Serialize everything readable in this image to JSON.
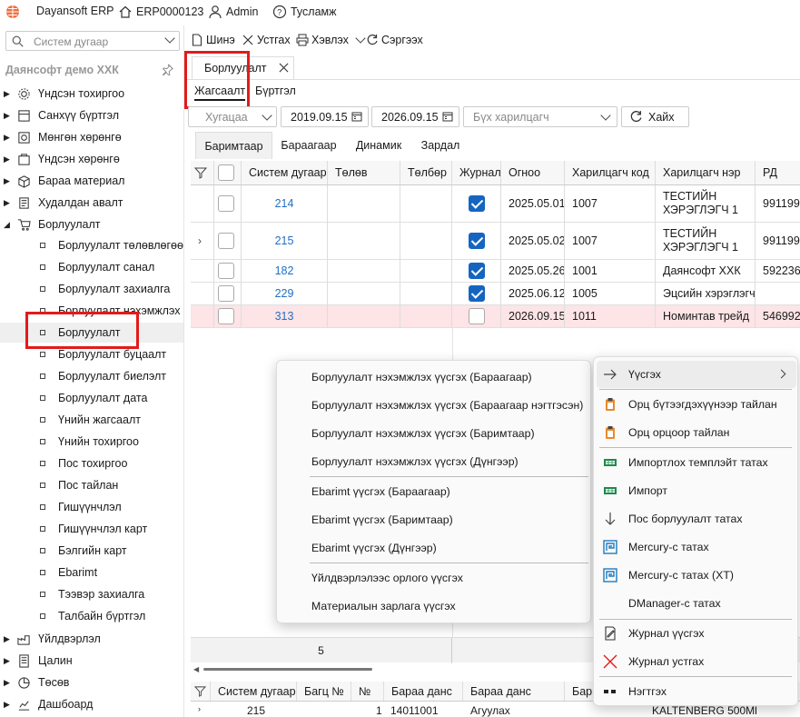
{
  "top": {
    "app": "Dayansoft ERP",
    "db": "ERP0000123",
    "user": "Admin",
    "help": "Тусламж"
  },
  "sidebar": {
    "search_placeholder": "Систем дугаар",
    "company": "Даянсофт демо ХХК",
    "top_items": [
      {
        "label": "Үндсэн тохиргоо",
        "icon": "gear-icon"
      },
      {
        "label": "Санхүү бүртгэл",
        "icon": "ledger-icon"
      },
      {
        "label": "Мөнгөн хөрөнгө",
        "icon": "money-icon"
      },
      {
        "label": "Үндсэн хөрөнгө",
        "icon": "asset-icon"
      },
      {
        "label": "Бараа материал",
        "icon": "box-icon"
      },
      {
        "label": "Худалдан авалт",
        "icon": "purchase-icon"
      },
      {
        "label": "Борлуулалт",
        "icon": "cart-icon"
      }
    ],
    "sub_items": [
      "Борлуулалт төлөвлөгөө",
      "Борлуулалт санал",
      "Борлуулалт захиалга",
      "Борлуулалт нэхэмжлэх",
      "Борлуулалт",
      "Борлуулалт буцаалт",
      "Борлуулалт биелэлт",
      "Борлуулалт дата",
      "Үнийн жагсаалт",
      "Үнийн тохиргоо",
      "Пос тохиргоо",
      "Пос тайлан",
      "Гишүүнчлэл",
      "Гишүүнчлэл карт",
      "Бэлгийн карт",
      "Ebarimt",
      "Тээвэр захиалга",
      "Талбайн бүртгэл"
    ],
    "bottom_items": [
      {
        "label": "Үйлдвэрлэл",
        "icon": "factory-icon"
      },
      {
        "label": "Цалин",
        "icon": "salary-icon"
      },
      {
        "label": "Төсөв",
        "icon": "pie-icon"
      },
      {
        "label": "Дашбоард",
        "icon": "dashboard-icon"
      }
    ]
  },
  "toolbar": {
    "new": "Шинэ",
    "delete": "Устгах",
    "print": "Хэвлэх",
    "refresh": "Сэргээх"
  },
  "doc_tab": {
    "label": "Борлуулалт"
  },
  "subtabs": {
    "list": "Жагсаалт",
    "register": "Бүртгэл"
  },
  "filters": {
    "period_placeholder": "Хугацаа",
    "date_from": "2019.09.15",
    "date_to": "2026.09.15",
    "partner_placeholder": "Бүх харилцагч",
    "search_button": "Хайх"
  },
  "tabs2": [
    "Баримтаар",
    "Бараагаар",
    "Динамик",
    "Зардал"
  ],
  "grid": {
    "headers": [
      "Систем дугаар",
      "Төлөв",
      "Төлбөр",
      "Журнал",
      "Огноо",
      "Харилцагч код",
      "Харилцагч нэр",
      "РД"
    ],
    "rows": [
      {
        "no": "214",
        "journal": true,
        "date": "2025.05.01",
        "code": "1007",
        "name1": "ТЕСТИЙН",
        "name2": "ХЭРЭГЛЭГЧ 1",
        "rd": "991199"
      },
      {
        "no": "215",
        "journal": true,
        "date": "2025.05.02",
        "code": "1007",
        "name1": "ТЕСТИЙН",
        "name2": "ХЭРЭГЛЭГЧ 1",
        "rd": "991199"
      },
      {
        "no": "182",
        "journal": true,
        "date": "2025.05.26",
        "code": "1001",
        "name1": "Даянсофт ХХК",
        "name2": "",
        "rd": "592236"
      },
      {
        "no": "229",
        "journal": true,
        "date": "2025.06.12",
        "code": "1005",
        "name1": "Эцсийн хэрэглэгч",
        "name2": "",
        "rd": ""
      },
      {
        "no": "313",
        "journal": false,
        "date": "2026.09.15",
        "code": "1011",
        "name1": "Номинтав трейд",
        "name2": "",
        "rd": "546992"
      }
    ],
    "count": "5"
  },
  "menu_left": [
    "Борлуулалт нэхэмжлэх үүсгэх (Бараагаар)",
    "Борлуулалт нэхэмжлэх үүсгэх (Бараагаар нэгтгэсэн)",
    "Борлуулалт нэхэмжлэх үүсгэх (Баримтаар)",
    "Борлуулалт нэхэмжлэх үүсгэх (Дүнгээр)",
    "Ebarimt үүсгэх (Бараагаар)",
    "Ebarimt үүсгэх (Баримтаар)",
    "Ebarimt үүсгэх (Дүнгээр)",
    "Үйлдвэрлэлээс орлого үүсгэх",
    "Материалын зарлага үүсгэх"
  ],
  "menu_right": [
    {
      "label": "Үүсгэх",
      "icon": "arrow-right-icon"
    },
    {
      "label": "Орц бүтээгдэхүүнээр тайлан",
      "icon": "clipboard-icon"
    },
    {
      "label": "Орц орцоор тайлан",
      "icon": "clipboard-icon"
    },
    {
      "label": "Импортлох темплэйт татах",
      "icon": "excel-icon"
    },
    {
      "label": "Импорт",
      "icon": "excel-icon"
    },
    {
      "label": "Пос борлуулалт татах",
      "icon": "arrow-down-icon"
    },
    {
      "label": "Mercury-с татах",
      "icon": "mercury-icon"
    },
    {
      "label": "Mercury-с татах (ХТ)",
      "icon": "mercury-icon"
    },
    {
      "label": "DManager-с татах",
      "icon": ""
    },
    {
      "label": "Журнал үүсгэх",
      "icon": "journal-icon"
    },
    {
      "label": "Журнал устгах",
      "icon": "red-x-icon"
    },
    {
      "label": "Нэгтгэх",
      "icon": "merge-icon"
    }
  ],
  "bottom_grid": {
    "headers": [
      "Систем дугаар",
      "Багц №",
      "№",
      "Бараа данс",
      "Бараа данс",
      "Бар"
    ],
    "row": [
      "215",
      "",
      "1",
      "14011001",
      "Агуулах",
      "KALTENBERG 500Ml"
    ]
  },
  "colors": {
    "accent": "#1565c0",
    "highlight_red": "#e21b1b",
    "link": "#1f6fc5",
    "row_pink": "#fde4e6"
  }
}
